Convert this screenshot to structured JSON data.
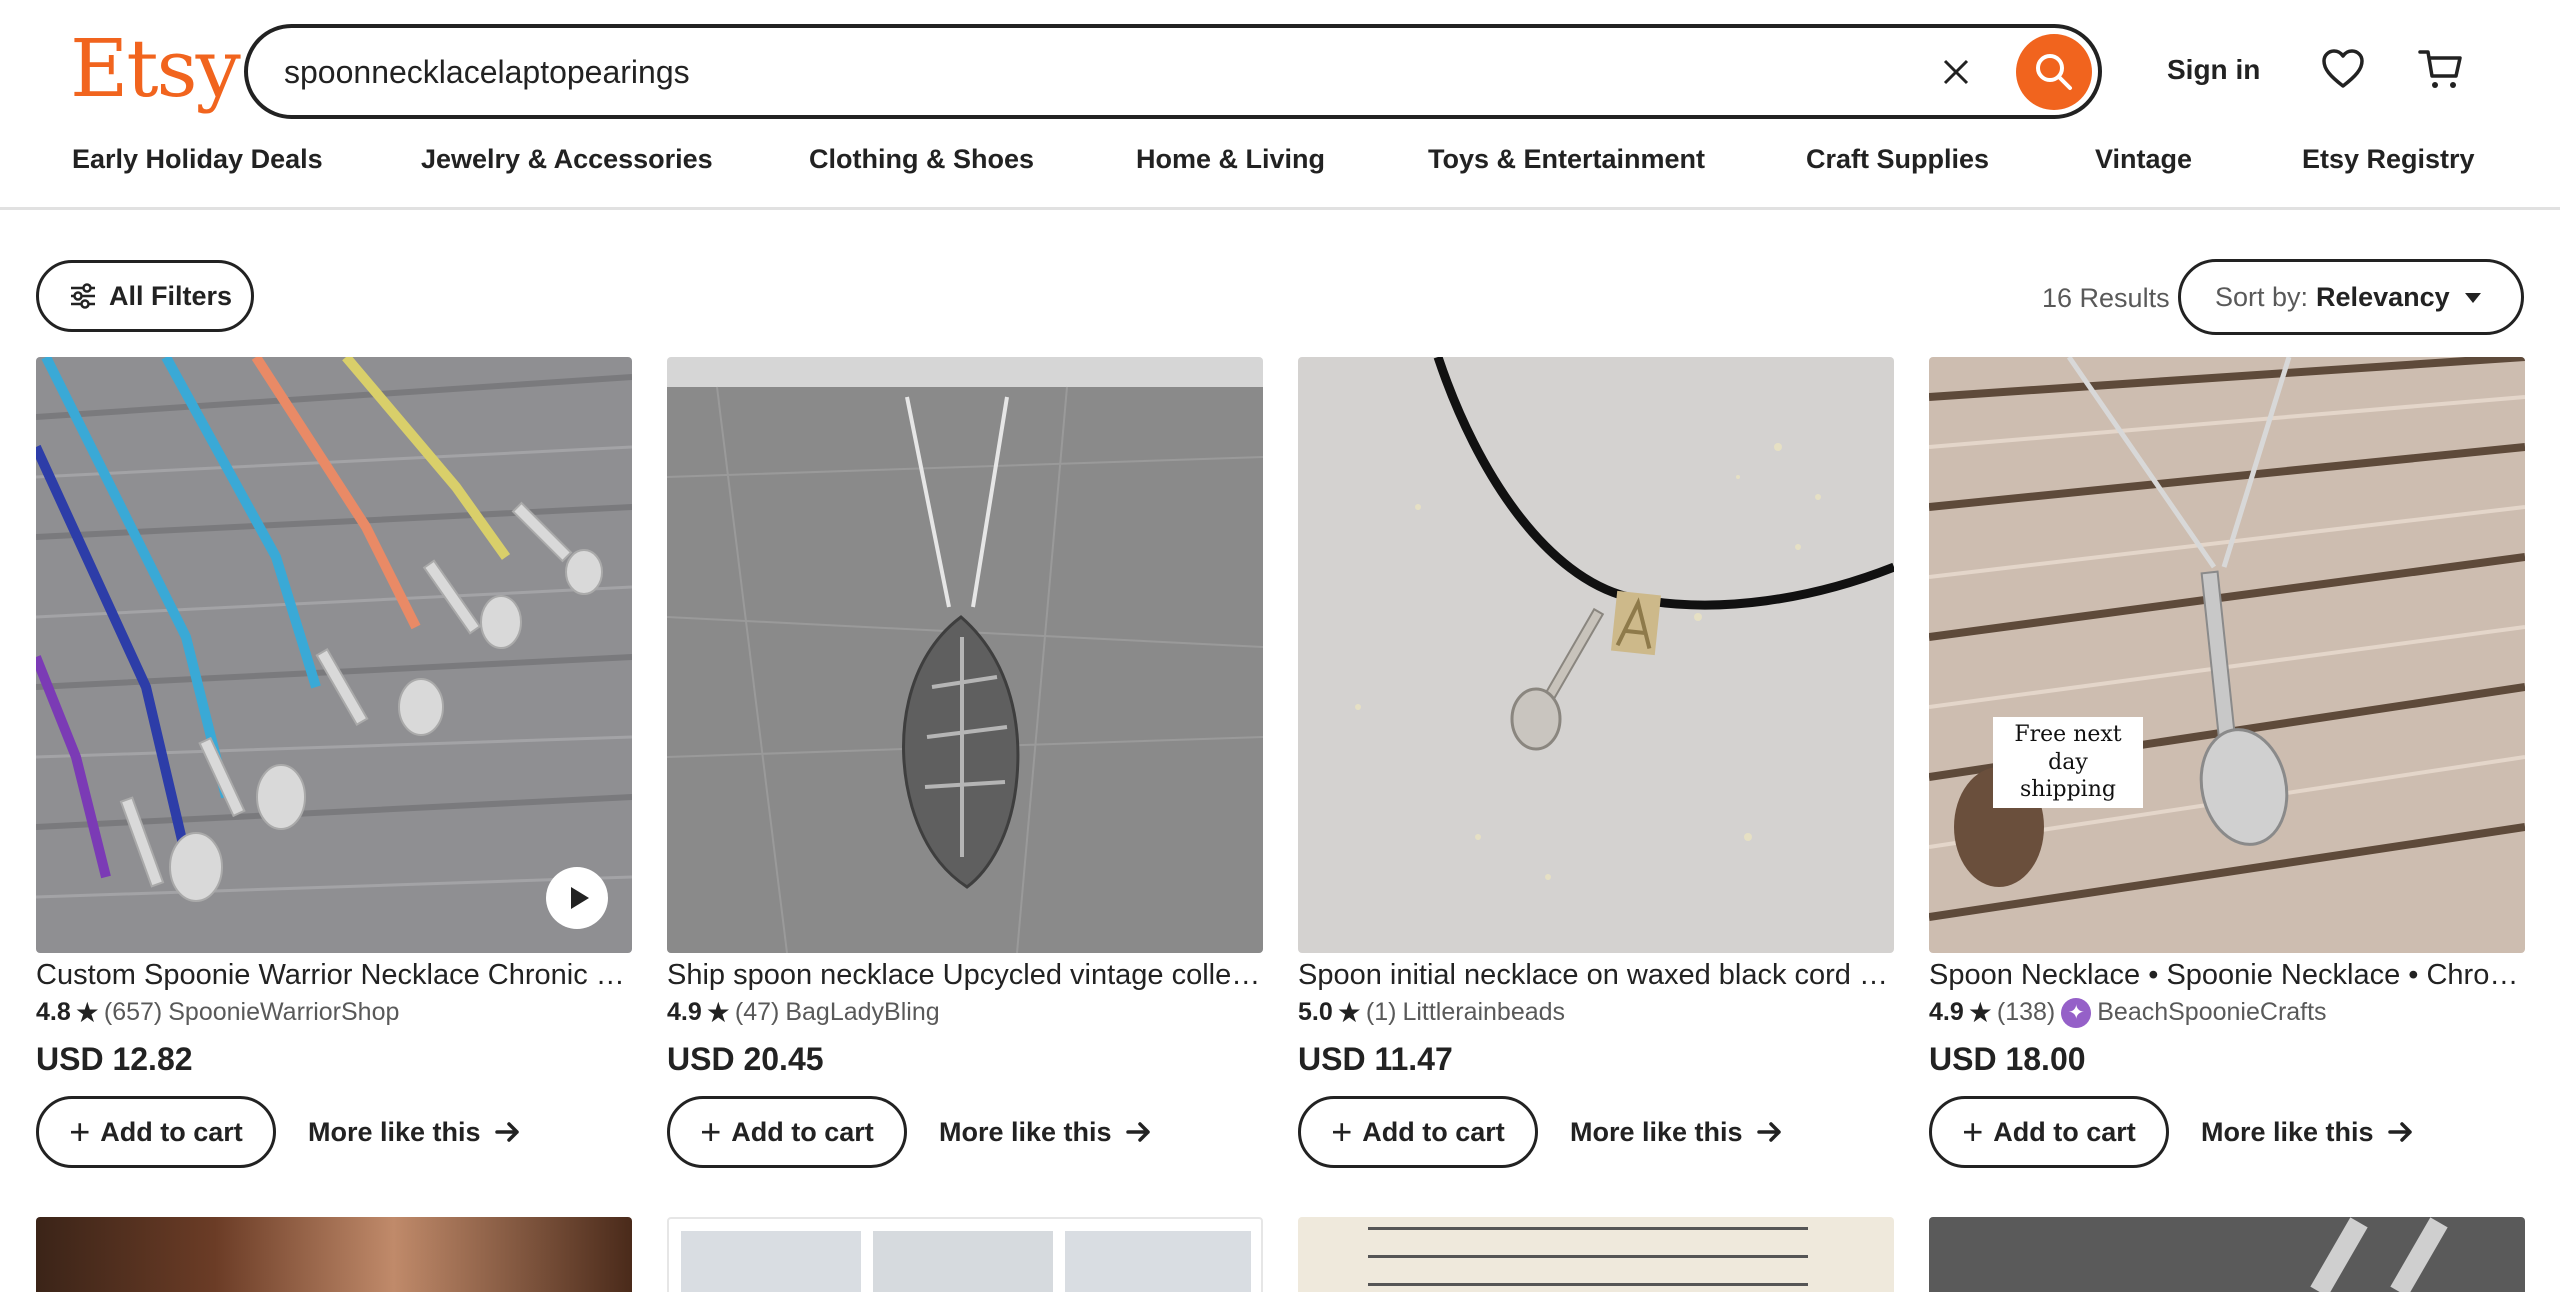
{
  "header": {
    "logo": "Etsy",
    "search_value": "spoonnecklacelaptopearings",
    "signin_label": "Sign in"
  },
  "nav": {
    "items": [
      "Early Holiday Deals",
      "Jewelry & Accessories",
      "Clothing & Shoes",
      "Home & Living",
      "Toys & Entertainment",
      "Craft Supplies",
      "Vintage",
      "Etsy Registry"
    ]
  },
  "toolbar": {
    "filters_label": "All Filters",
    "results_text": "16 Results",
    "sort_label": "Sort by:",
    "sort_value": "Relevancy"
  },
  "products": [
    {
      "title": "Custom Spoonie Warrior Necklace Chronic Illness Awareness",
      "rating": "4.8",
      "reviews": "(657)",
      "shop": "SpoonieWarriorShop",
      "price": "USD 12.82",
      "add_label": "Add to cart",
      "more_label": "More like this"
    },
    {
      "title": "Ship spoon necklace Upcycled vintage collectible spoon",
      "rating": "4.9",
      "reviews": "(47)",
      "shop": "BagLadyBling",
      "price": "USD 20.45",
      "add_label": "Add to cart",
      "more_label": "More like this"
    },
    {
      "title": "Spoon initial necklace on waxed black cord choker",
      "rating": "5.0",
      "reviews": "(1)",
      "shop": "Littlerainbeads",
      "price": "USD 11.47",
      "add_label": "Add to cart",
      "more_label": "More like this"
    },
    {
      "title": "Spoon Necklace • Spoonie Necklace • Chronic Illness",
      "rating": "4.9",
      "reviews": "(138)",
      "shop": "BeachSpoonieCrafts",
      "price": "USD 18.00",
      "add_label": "Add to cart",
      "more_label": "More like this",
      "image_overlay": "Free next day shipping"
    }
  ],
  "colors": {
    "brand": "#f1641e",
    "text": "#222222",
    "muted": "#595959",
    "star_seller": "#9560c8"
  }
}
